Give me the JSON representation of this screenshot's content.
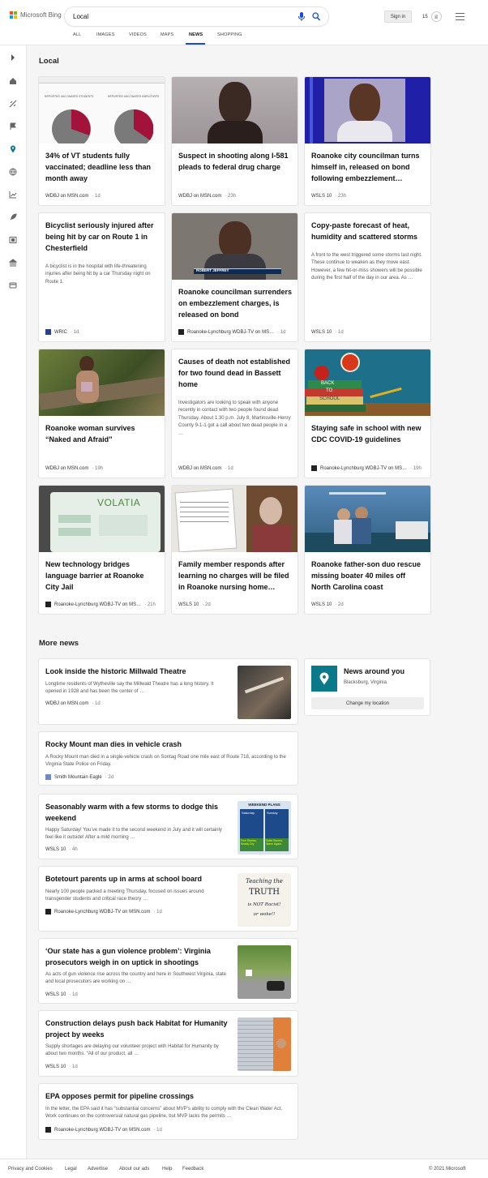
{
  "brand": {
    "name": "Microsoft Bing",
    "colors": [
      "#f25022",
      "#7fba00",
      "#00a4ef",
      "#ffb900"
    ]
  },
  "search": {
    "query": "Local"
  },
  "header": {
    "signin": "Sign in",
    "rewards": "15"
  },
  "tabs": [
    "ALL",
    "IMAGES",
    "VIDEOS",
    "MAPS",
    "NEWS",
    "SHOPPING"
  ],
  "active_tab": "NEWS",
  "accent": "#174ae4",
  "local": {
    "heading": "Local",
    "cards": [
      {
        "title": "34% of VT students fully vaccinated; deadline less than month away",
        "source": "WDBJ on MSN.com",
        "time": "1d",
        "img_labels": [
          "REPORTED VACCINATED STUDENTS",
          "REPORTED VACCINATED EMPLOYEES"
        ]
      },
      {
        "title": "Suspect in shooting along I-581 pleads to federal drug charge",
        "source": "WDBJ on MSN.com",
        "time": "23h"
      },
      {
        "title": "Roanoke city councilman turns himself in, released on bond following embezzlement…",
        "source": "WSLS 10",
        "time": "23h"
      },
      {
        "title": "Bicyclist seriously injured after being hit by car on Route 1 in Chesterfield",
        "snippet": "A bicyclist is in the hospital with life-threatening injuries after being hit by a car Thursday night on Route 1.",
        "source": "WRIC",
        "time": "1d"
      },
      {
        "title": "Roanoke councilman surrenders on embezzlement charges, is released on bond",
        "source": "Roanoke-Lynchburg WDBJ-TV on MS…",
        "time": "1d",
        "img_caption": "ROBERT JEFFREY"
      },
      {
        "title": "Copy-paste forecast of heat, humidity and scattered storms",
        "snippet": "A front to the west triggered some storms last night. These continue to weaken as they move east. However, a few hit-or-miss showers will be possible during the first half of the day in our area. As …",
        "source": "WSLS 10",
        "time": "1d"
      },
      {
        "title": "Roanoke woman survives “Naked and Afraid”",
        "source": "WDBJ on MSN.com",
        "time": "19h"
      },
      {
        "title": "Causes of death not established for two found dead in Bassett home",
        "snippet": "Investigators are looking to speak with anyone recently in contact with two people found dead Thursday. About 1:30 p.m. July 8, Martinsville-Henry County 9-1-1 got a call about two dead people in a …",
        "source": "WDBJ on MSN.com",
        "time": "1d"
      },
      {
        "title": "Staying safe in school with new CDC COVID-19 guidelines",
        "source": "Roanoke-Lynchburg WDBJ-TV on MS…",
        "time": "19h",
        "img_books": [
          "BACK",
          "TO",
          "SCHOOL"
        ]
      },
      {
        "title": "New technology bridges language barrier at Roanoke City Jail",
        "source": "Roanoke-Lynchburg WDBJ-TV on MS…",
        "time": "21h",
        "img_word": "VOLATIA"
      },
      {
        "title": "Family member responds after learning no charges will be filed in Roanoke nursing home…",
        "source": "WSLS 10",
        "time": "2d"
      },
      {
        "title": "Roanoke father-son duo rescue missing boater 40 miles off North Carolina coast",
        "source": "WSLS 10",
        "time": "2d"
      }
    ]
  },
  "more": {
    "heading": "More news",
    "items": [
      {
        "title": "Look inside the historic Millwald Theatre",
        "snippet": "Longtime residents of Wytheville say the Millwald Theatre has a long history. It opened in 1928 and has been the center of …",
        "source": "WDBJ on MSN.com",
        "time": "1d"
      },
      {
        "title": "Rocky Mount man dies in vehicle crash",
        "snippet": "A Rocky Mount man died in a single-vehicle crash on Sontag Road one mile east of Route 718, according to the Virginia State Police on Friday.",
        "source": "Smith Mountain Eagle",
        "time": "2d"
      },
      {
        "title": "Seasonably warm with a few storms to dodge this weekend",
        "snippet": "Happy Saturday! You’ve made it to the second weekend in July and it will certainly feel like it outside! After a mild morning …",
        "source": "WSLS 10",
        "time": "4h",
        "thumb": {
          "title": "WEEKEND PLANS",
          "days": [
            "Saturday",
            "Sunday"
          ],
          "notes": [
            "Few Storms, Mostly Dry",
            "Scttd Storms, Warm Again"
          ]
        }
      },
      {
        "title": "Botetourt parents up in arms at school board",
        "snippet": "Nearly 100 people packed a meeting Thursday, focused on issues around transgender students and critical race theory …",
        "source": "Roanoke-Lynchburg WDBJ-TV on MSN.com",
        "time": "1d",
        "thumb_text": [
          "Teaching the",
          "TRUTH",
          "is NOT Racist!",
          "or woke!!"
        ]
      },
      {
        "title": "‘Our state has a gun violence problem’: Virginia prosecutors weigh in on uptick in shootings",
        "snippet": "As acts of gun violence rise across the country and here in Southwest Virginia, state and local prosecutors are working on …",
        "source": "WSLS 10",
        "time": "1d"
      },
      {
        "title": "Construction delays push back Habitat for Humanity project by weeks",
        "snippet": "Supply shortages are delaying our volunteer project with Habitat for Humanity by about two months. “All of our product, all …",
        "source": "WSLS 10",
        "time": "1d"
      },
      {
        "title": "EPA opposes permit for pipeline crossings",
        "snippet": "In the letter, the EPA said it has “substantial concerns” about MVP’s ability to comply with the Clean Water Act. Work continues on the controversial natural gas pipeline, but MVP lacks the permits …",
        "source": "Roanoke-Lynchburg WDBJ-TV on MSN.com",
        "time": "1d"
      }
    ]
  },
  "news_around": {
    "title": "News around you",
    "location": "Blacksburg, Virginia",
    "button": "Change my location"
  },
  "footer": {
    "links": [
      "Privacy and Cookies",
      "Legal",
      "Advertise",
      "About our ads",
      "Help",
      "Feedback"
    ],
    "copyright": "© 2021 Microsoft"
  }
}
